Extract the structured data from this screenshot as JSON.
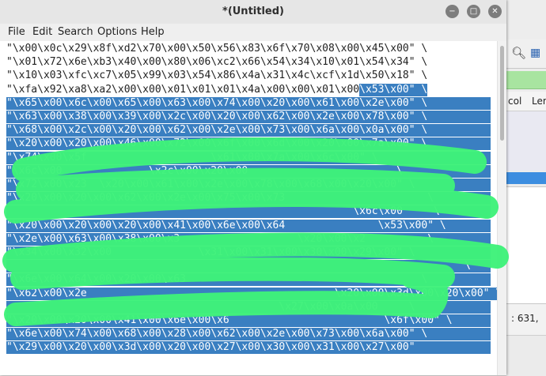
{
  "window": {
    "title": "*(Untitled)"
  },
  "menu": [
    "File",
    "Edit",
    "Search",
    "Options",
    "Help"
  ],
  "editor": {
    "lines": [
      {
        "text": "\"\\x00\\x0c\\x29\\x8f\\xd2\\x70\\x00\\x50\\x56\\x83\\x6f\\x70\\x08\\x00\\x45\\x00\" \\",
        "sel_from": -1
      },
      {
        "text": "\"\\x01\\x72\\x6e\\xb3\\x40\\x00\\x80\\x06\\xc2\\x66\\x54\\x34\\x10\\x01\\x54\\x34\" \\",
        "sel_from": -1
      },
      {
        "text": "\"\\x10\\x03\\xfc\\xc7\\x05\\x99\\x03\\x54\\x86\\x4a\\x31\\x4c\\xcf\\x1d\\x50\\x18\" \\",
        "sel_from": -1
      },
      {
        "text": "\"\\xfa\\x92\\xa8\\xa2\\x00\\x00\\x01\\x01\\x01\\x4a\\x00\\x00\\x01\\x00\\x53\\x00\" \\",
        "sel_from": 57
      },
      {
        "text": "\"\\x65\\x00\\x6c\\x00\\x65\\x00\\x63\\x00\\x74\\x00\\x20\\x00\\x61\\x00\\x2e\\x00\" \\",
        "sel_from": 0
      },
      {
        "text": "\"\\x63\\x00\\x38\\x00\\x39\\x00\\x2c\\x00\\x20\\x00\\x62\\x00\\x2e\\x00\\x78\\x00\" \\",
        "sel_from": 0
      },
      {
        "text": "\"\\x68\\x00\\x2c\\x00\\x20\\x00\\x62\\x00\\x2e\\x00\\x73\\x00\\x6a\\x00\\x0a\\x00\" \\",
        "sel_from": 0
      },
      {
        "text": "\"\\x20\\x00\\x20\\x00\\x46\\x00\\x72\\x00\\x6f\\x00\\x6d\\x00\\x20\\x00\\x7a\\x00\" \\",
        "sel_from": 0
      },
      {
        "text": "\"\\x74\\x00\\x5f                    \\x61\\x00\\x7a\\x00\\x6c\\x00\" \\",
        "sel_from": 0
      },
      {
        "text": "\"\\x6c\\x00              \\x2c\\x00\\x20\\x00                        \\",
        "sel_from": 0
      },
      {
        "text": "\"\\x72\\x00\\x23  \\x20\\x00\\x61\\x00\\x2e\\x00\\x78\\x00\\x68\\x00\\x20\\x00\" \\",
        "sel_from": 0
      },
      {
        "text": "\"\\x20\\x00\\x20\\x00\\x62\\x00\\x2e\\x00\\x75\\x00\\x73                       \\",
        "sel_from": 0
      },
      {
        "text": "                                                        \\x6c\\x00     \\",
        "sel_from": 0
      },
      {
        "text": "\"\\x20\\x00\\x20\\x00\\x20\\x00\\x41\\x00\\x6e\\x00\\x64               \\x53\\x00\" \\",
        "sel_from": 0
      },
      {
        "text": "\"\\x2e\\x00\\x63\\x00\\x38\\x00\\x3                   \\x20\\x00\\x2          \\",
        "sel_from": 0
      },
      {
        "text": "\"\\x34\\x00\\x32\\x00              \\x31\\x00\\x31\\x00\\x30\\x00\\x29\\x00\" \\",
        "sel_from": 0
      },
      {
        "text": "                                                                          \\",
        "sel_from": 0
      },
      {
        "text": "\"\\x6e\\x00\\x64\\x00\\x20\\x00\\x63                                      \\",
        "sel_from": 0
      },
      {
        "text": "\"\\x62\\x00\\x2e                                        \\x20\\x00\\x3d\\x00\\x20\\x00\" \\",
        "sel_from": 0
      },
      {
        "text": "                                            \\x27\\x00\\x0a\\x00     \\",
        "sel_from": 0
      },
      {
        "text": "\"\\x20\\x00\\x20\\x00\\x41\\x00\\x6e\\x00\\x6                         \\x6f\\x00\" \\",
        "sel_from": 0
      },
      {
        "text": "\"\\x6e\\x00\\x74\\x00\\x68\\x00\\x28\\x00\\x62\\x00\\x2e\\x00\\x73\\x00\\x6a\\x00\" \\",
        "sel_from": 0
      },
      {
        "text": "\"\\x29\\x00\\x20\\x00\\x3d\\x00\\x20\\x00\\x27\\x00\\x30\\x00\\x31\\x00\\x27\\x00\"",
        "sel_from": 0
      }
    ]
  },
  "bg_app": {
    "col_header_1": "col",
    "col_header_2": "Len",
    "status_text": ": 631,"
  },
  "colors": {
    "selection": "#3a7fc1",
    "scribble": "#3ff27a"
  },
  "icons": [
    "minimize-icon",
    "maximize-icon",
    "close-icon",
    "zoom-icon",
    "grid-icon"
  ]
}
